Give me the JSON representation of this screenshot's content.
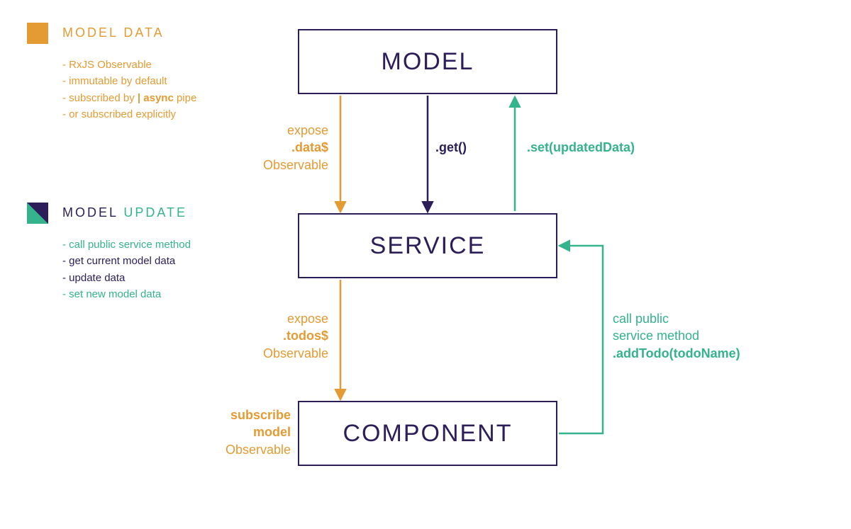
{
  "colors": {
    "orange": "#e49b34",
    "green": "#34b38c",
    "purple": "#2d1e59"
  },
  "boxes": {
    "model": "MODEL",
    "service": "SERVICE",
    "component": "COMPONENT"
  },
  "legend": {
    "data": {
      "title": "MODEL DATA",
      "items": {
        "i1": "- RxJS Observable",
        "i2": "- immutable by default",
        "i3_a": "- subscribed by ",
        "i3_b": "| async",
        "i3_c": " pipe",
        "i4": "- or subscribed explicitly"
      }
    },
    "update": {
      "title_a": "MODEL ",
      "title_b": "UPDATE",
      "items": {
        "i1": "- call public service method",
        "i2": "- get current model data",
        "i3": "- update data",
        "i4": "- set new model data"
      }
    }
  },
  "arrows": {
    "data_expose": {
      "l1": "expose",
      "l2": ".data$",
      "l3": "Observable"
    },
    "get": ".get()",
    "set": ".set(updatedData)",
    "todos_expose": {
      "l1": "expose",
      "l2": ".todos$",
      "l3": "Observable"
    },
    "call_service": {
      "l1": "call public",
      "l2": "service method",
      "l3": ".addTodo(todoName)"
    },
    "subscribe": {
      "l1": "subscribe",
      "l2": "model",
      "l3": "Observable"
    }
  }
}
